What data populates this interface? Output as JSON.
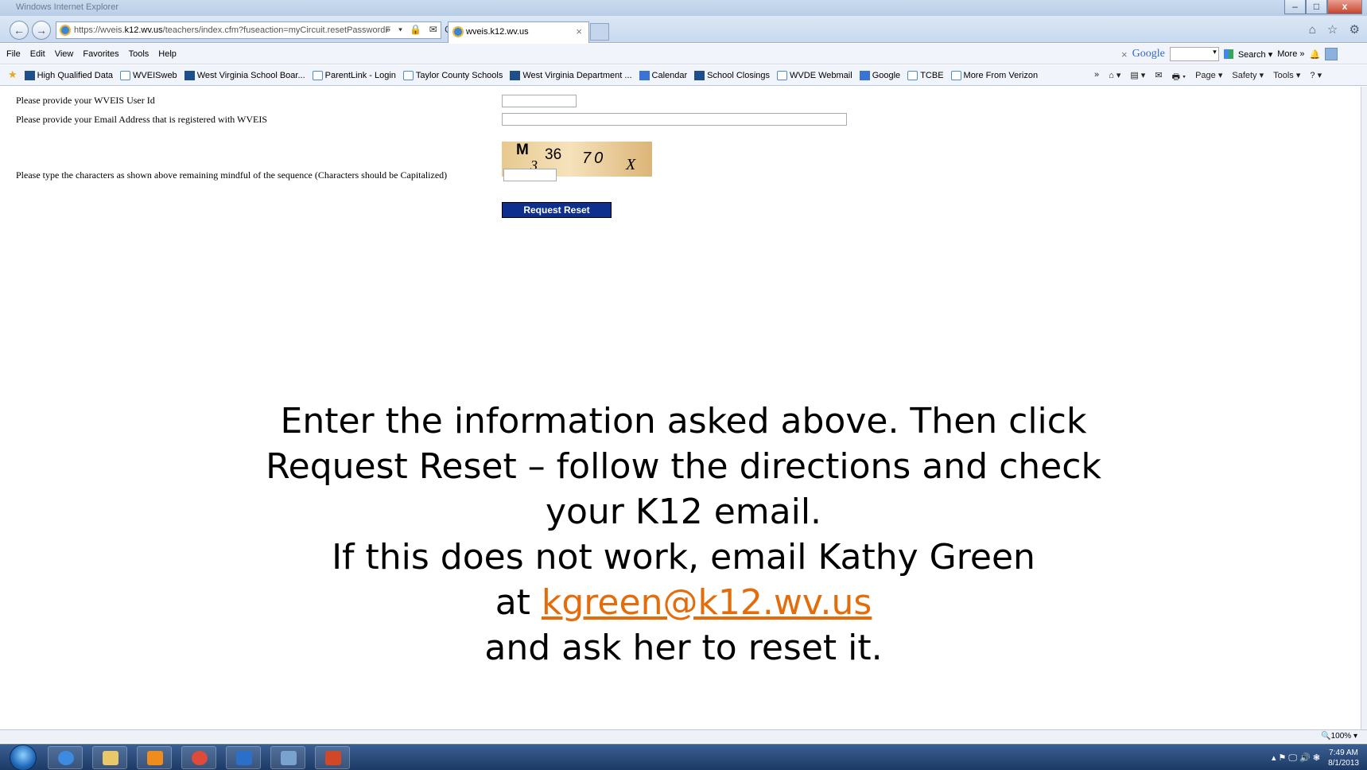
{
  "window": {
    "title": "Windows Internet Explorer",
    "minimize": "–",
    "maximize": "□",
    "close": "x"
  },
  "address": {
    "prefix": "https://wveis.",
    "domain": "k12.wv.us",
    "path": "/teachers/index.cfm?fuseaction=myCircuit.resetPasswordF",
    "tools": "⌕ ▾ 🔒 ✉ C"
  },
  "tab": {
    "label": "wveis.k12.wv.us",
    "close": "×"
  },
  "right_icons": "⌂ ☆ ⚙",
  "menu": [
    "File",
    "Edit",
    "View",
    "Favorites",
    "Tools",
    "Help"
  ],
  "google_bar": {
    "close": "×",
    "logo": "Google",
    "dropdown": "▾",
    "search": "Search ▾",
    "more": "More »",
    "bell": "🔔"
  },
  "favorites": [
    {
      "label": "High Qualified Data",
      "icon": "site-icon"
    },
    {
      "label": "WVEISweb",
      "icon": "ie-page-icon"
    },
    {
      "label": "West Virginia School Boar...",
      "icon": "site-icon"
    },
    {
      "label": "ParentLink - Login",
      "icon": "ie-page-icon"
    },
    {
      "label": "Taylor County Schools",
      "icon": "ie-page-icon"
    },
    {
      "label": "West Virginia Department ...",
      "icon": "site-icon"
    },
    {
      "label": "Calendar",
      "icon": "google-icon"
    },
    {
      "label": "School Closings",
      "icon": "site-icon"
    },
    {
      "label": "WVDE Webmail",
      "icon": "ie-page-icon"
    },
    {
      "label": "Google",
      "icon": "google-icon"
    },
    {
      "label": "TCBE",
      "icon": "ie-page-icon"
    },
    {
      "label": "More From Verizon",
      "icon": "ie-page-icon"
    }
  ],
  "command_bar": [
    "»",
    "⌂ ▾",
    "▤ ▾",
    "✉",
    "🖶 ▾",
    "Page ▾",
    "Safety ▾",
    "Tools ▾",
    "? ▾"
  ],
  "form": {
    "userid_label": "Please provide your WVEIS User Id",
    "email_label": "Please provide your Email Address that is registered with WVEIS",
    "captcha_label": "Please type the characters as shown above remaining mindful of the sequence (Characters should be Capitalized)",
    "captcha_chars": [
      "M",
      "3",
      "36",
      "70",
      "X"
    ],
    "submit_label": "Request Reset"
  },
  "instructions": {
    "line1": "Enter the information asked above.  Then click",
    "line2": "Request Reset – follow the directions and check",
    "line3": "your K12 email.",
    "line4": "If this does not work, email Kathy Green",
    "line5_prefix": "at ",
    "email_link": "kgreen@k12.wv.us",
    "line6": "and ask her to reset it."
  },
  "status": {
    "zoom": "🔍100%  ▾"
  },
  "taskbar": {
    "clock_time": "7:49 AM",
    "clock_date": "8/1/2013",
    "tray": "▴  ⚑  🖵  🔊  ❃",
    "icons": [
      {
        "name": "ie-taskbar-icon",
        "color": "#3d8be0"
      },
      {
        "name": "explorer-taskbar-icon",
        "color": "#e9c86a"
      },
      {
        "name": "media-player-taskbar-icon",
        "color": "#f08b1e"
      },
      {
        "name": "chrome-taskbar-icon",
        "color": "#e04a3a"
      },
      {
        "name": "outlook-taskbar-icon",
        "color": "#2a6fc9"
      },
      {
        "name": "remote-desktop-taskbar-icon",
        "color": "#7aa2cf"
      },
      {
        "name": "powerpoint-taskbar-icon",
        "color": "#d24726"
      }
    ]
  }
}
